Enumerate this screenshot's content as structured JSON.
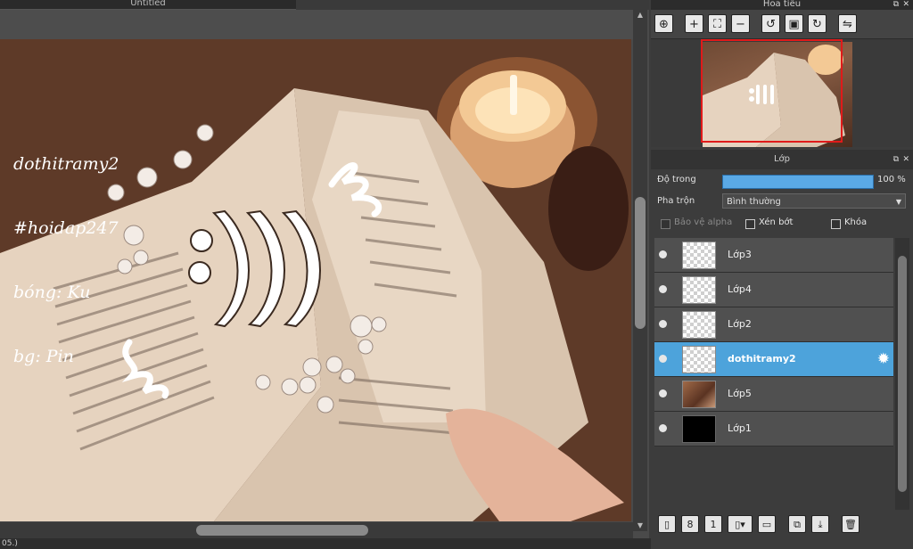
{
  "canvas": {
    "tab_title": "Untitled",
    "status_text": "05.)",
    "artwork_text": [
      "dothitramy2",
      "#hoidap247",
      "bóng: Ku",
      "bg: Pin"
    ]
  },
  "navigator": {
    "title": "Hoa tiêu",
    "toolbar": [
      {
        "name": "zoom-actual-icon",
        "glyph": "⊕"
      },
      {
        "name": "zoom-in-icon",
        "glyph": "＋"
      },
      {
        "name": "fit-screen-icon",
        "glyph": "⛶"
      },
      {
        "name": "zoom-out-icon",
        "glyph": "−"
      },
      {
        "name": "rotate-left-icon",
        "glyph": "↺"
      },
      {
        "name": "fit-icon",
        "glyph": "▣"
      },
      {
        "name": "rotate-right-icon",
        "glyph": "↻"
      },
      {
        "name": "flip-horizontal-icon",
        "glyph": "⇋"
      }
    ]
  },
  "layers_panel": {
    "title": "Lớp",
    "opacity_label": "Độ trong",
    "opacity_value": "100 %",
    "opacity": 1.0,
    "blend_label": "Pha trộn",
    "blend_value": "Bình thường",
    "protect_alpha_label": "Bảo vệ alpha",
    "clipping_label": "Xén bớt",
    "lock_label": "Khóa",
    "layers": [
      {
        "name": "Lớp3",
        "thumb": "transparent",
        "selected": false
      },
      {
        "name": "Lớp4",
        "thumb": "transparent",
        "selected": false
      },
      {
        "name": "Lớp2",
        "thumb": "transparent",
        "selected": false
      },
      {
        "name": "dothitramy2",
        "thumb": "transparent",
        "selected": true
      },
      {
        "name": "Lớp5",
        "thumb": "photo",
        "selected": false
      },
      {
        "name": "Lớp1",
        "thumb": "black",
        "selected": false
      }
    ],
    "bottom_toolbar": [
      "new-layer-icon",
      "new-layer-8bit-icon",
      "new-layer-1bit-icon",
      "add-layer-menu-icon",
      "new-folder-icon",
      "duplicate-layer-icon",
      "merge-down-icon",
      "delete-layer-icon"
    ]
  },
  "colors": {
    "selected_layer": "#4da3db",
    "opacity_bar": "#5aa9e6",
    "navigator_frame": "#e01a1a"
  }
}
